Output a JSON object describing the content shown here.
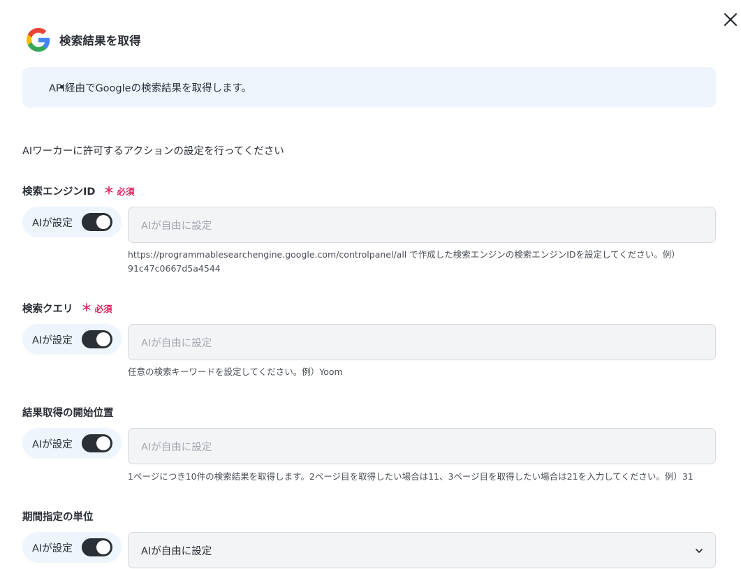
{
  "header": {
    "title": "検索結果を取得",
    "logo_icon": "google-g-icon"
  },
  "info": {
    "items": [
      "API経由でGoogleの検索結果を取得します。"
    ]
  },
  "intro": "AIワーカーに許可するアクションの設定を行ってください",
  "fields": [
    {
      "label": "検索エンジンID",
      "required_label": "必須",
      "ai_label": "AIが設定",
      "ai_enabled": true,
      "placeholder": "AIが自由に設定",
      "help_line1": "https://programmablesearchengine.google.com/controlpanel/all で作成した検索エンジンの検索エンジンIDを設定してください。例）",
      "help_line2": "91c47c0667d5a4544"
    },
    {
      "label": "検索クエリ",
      "required_label": "必須",
      "ai_label": "AIが設定",
      "ai_enabled": true,
      "placeholder": "AIが自由に設定",
      "help_line1": "任意の検索キーワードを設定してください。例）Yoom"
    },
    {
      "label": "結果取得の開始位置",
      "ai_label": "AIが設定",
      "ai_enabled": true,
      "placeholder": "AIが自由に設定",
      "help_line1": "1ページにつき10件の検索結果を取得します。2ページ目を取得したい場合は11、3ページ目を取得したい場合は21を入力してください。例）31"
    },
    {
      "label": "期間指定の単位",
      "ai_label": "AIが設定",
      "ai_enabled": true,
      "selected_value": "AIが自由に設定"
    }
  ],
  "required_mark": "＊",
  "colors": {
    "required": "#e0245e",
    "toggle_on": "#2b2f36",
    "info_bg": "#eef5fc",
    "input_bg": "#f3f4f6"
  }
}
